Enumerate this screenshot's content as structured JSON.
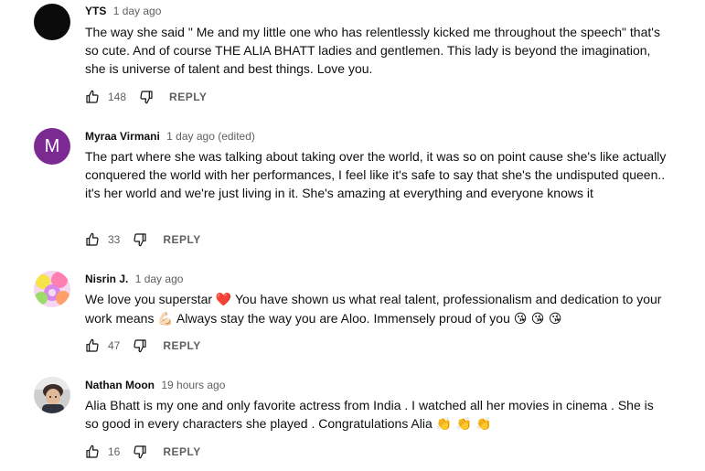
{
  "comments": [
    {
      "author": "YTS",
      "time": "1 day ago",
      "text": "The way she said \" Me and my little one who has relentlessly kicked me throughout the speech\" that's so cute. And of course THE ALIA BHATT ladies and gentlemen. This lady is beyond the imagination, she is universe of talent and best things. Love you.",
      "likes": "148",
      "reply_label": "REPLY",
      "avatar": "black-circle"
    },
    {
      "author": "Myraa Virmani",
      "time": "1 day ago (edited)",
      "text": "The part where she was talking about taking over the world, it was so on point cause she's like actually conquered the world with her performances, I feel like it's safe to say that she's the undisputed queen.. it's her world and we're just living in it. She's amazing at everything and everyone knows it",
      "likes": "33",
      "reply_label": "REPLY",
      "avatar_letter": "M",
      "avatar_color": "#7b2a92"
    },
    {
      "author": "Nisrin J.",
      "time": "1 day ago",
      "text_parts": [
        "We love you superstar ",
        "❤️",
        " You have shown us what real talent, professionalism and dedication to your work means ",
        "💪🏻",
        " Always stay the way you are Aloo. Immensely proud of you ",
        "😘 😘 😘"
      ],
      "likes": "47",
      "reply_label": "REPLY",
      "avatar": "colorful-pattern"
    },
    {
      "author": "Nathan Moon",
      "time": "19 hours ago",
      "text_parts": [
        "Alia Bhatt is my one and only favorite actress from India . I watched all her movies in cinema . She is so good in every characters she played . Congratulations Alia ",
        "👏 👏 👏"
      ],
      "likes": "16",
      "reply_label": "REPLY",
      "avatar": "photo-person"
    }
  ],
  "icons": {
    "like": "thumbs-up-icon",
    "dislike": "thumbs-down-icon"
  },
  "colors": {
    "text": "#0f0f0f",
    "secondary": "#606060",
    "heart": "#e0245e"
  }
}
